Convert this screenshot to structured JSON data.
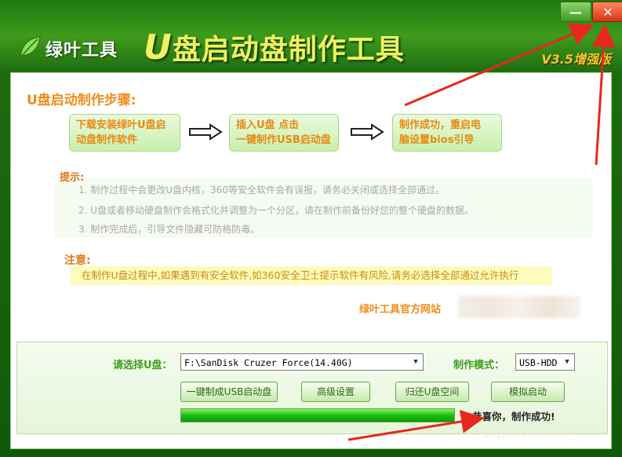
{
  "app": {
    "brand": "绿叶工具",
    "title_u": "U",
    "title_rest": "盘启动盘制作工具",
    "version": "V3.5增强版",
    "min_symbol": "—",
    "close_symbol": "✕"
  },
  "steps": {
    "heading": "U盘启动制作步骤:",
    "items": [
      {
        "line1": "下载安装绿叶U盘启",
        "line2": "动盘制作软件"
      },
      {
        "line1": "插入U盘 点击",
        "line2": "一键制作USB启动盘"
      },
      {
        "line1": "制作成功，重启电",
        "line2": "脑设置bios引导"
      }
    ]
  },
  "tips": {
    "heading": "提示:",
    "items": [
      "1. 制作过程中会更改U盘内核，360等安全软件会有误报，请务必关闭或选择全部通过。",
      "2. U盘或者移动硬盘制作会格式化并调整为一个分区，请在制作前备份好您的整个硬盘的数据。",
      "3. 制作完成后，引导文件隐藏可防格防毒。"
    ]
  },
  "notice": {
    "heading": "注意:",
    "text": "在制作U盘过程中,如果遇到有安全软件,如360安全卫士提示软件有风险,请务必选择全部通过允许执行"
  },
  "site": {
    "label": "绿叶工具官方网站"
  },
  "controls": {
    "usb_label": "请选择U盘：",
    "usb_value": "F:\\SanDisk Cruzer Force(14.40G)",
    "mode_label": "制作模式：",
    "mode_value": "USB-HDD",
    "buttons": {
      "one_click": "一键制成USB启动盘",
      "advanced": "高级设置",
      "restore": "归还U盘空间",
      "simulate": "模拟启动"
    },
    "progress": 1.0,
    "status": "恭喜你，制作成功!"
  },
  "watermark": "jingyan.baidu.com",
  "colors": {
    "accent_orange": "#f08c1a",
    "brand_green": "#3da020",
    "arrow_red": "#e8281e"
  }
}
